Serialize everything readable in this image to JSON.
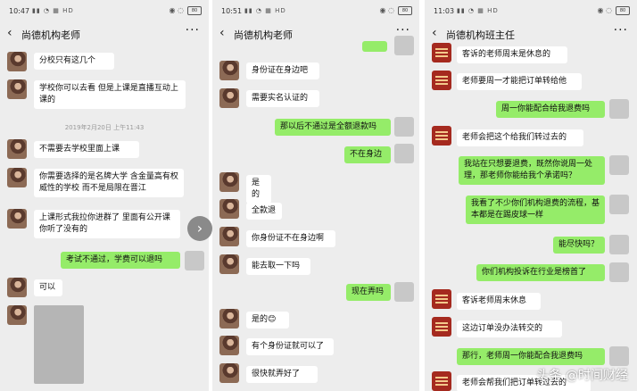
{
  "panels": [
    {
      "time": "10:47",
      "signal": "HD",
      "battery": "80",
      "title": "尚德机构老师",
      "timestamp": "2019年2月20日 上午11:43",
      "messages": [
        "分校只有这几个",
        "学校你可以去看 但是上课是直播互动上课的",
        "不需要去学校里面上课",
        "你需要选择的是名牌大学 含金量高有权威性的学校 而不是局限在晋江",
        "上课形式我拉你进群了 里面有公开课 你听了没有的",
        "考试不通过，学费可以退吗",
        "可以"
      ]
    },
    {
      "time": "10:51",
      "signal": "HD",
      "battery": "80",
      "title": "尚德机构老师",
      "messages": [
        "身份证在身边吧",
        "需要实名认证的",
        "那以后不通过是全额退款吗",
        "不在身边",
        "是的",
        "全款退",
        "你身份证不在身边啊",
        "能去取一下吗",
        "现在弄吗",
        "是的😊",
        "有个身份证就可以了",
        "很快就弄好了"
      ]
    },
    {
      "time": "11:03",
      "signal": "HD",
      "battery": "80",
      "title": "尚德机构班主任",
      "messages": [
        "客诉的老师周末是休息的",
        "老师要周一才能把订单转给他",
        "周一你能配合给我退费吗",
        "老师会把这个给我们转过去的",
        "我站在只想要退费，既然你说周一处理，那老师你能给我个承诺吗？",
        "我看了不少你们机构退费的流程，基本都是在踢皮球一样",
        "能尽快吗？",
        "你们机构投诉在行业是榜首了",
        "客诉老师周末休息",
        "这边订单没办法转交的",
        "那行，老师周一你能配合我退费吗",
        "老师会帮我们把订单转过去的"
      ]
    }
  ],
  "watermark": "头条 @时间财经",
  "colors": {
    "sent_bubble": "#95ec69",
    "recv_bubble": "#ffffff",
    "background": "#ededed"
  }
}
